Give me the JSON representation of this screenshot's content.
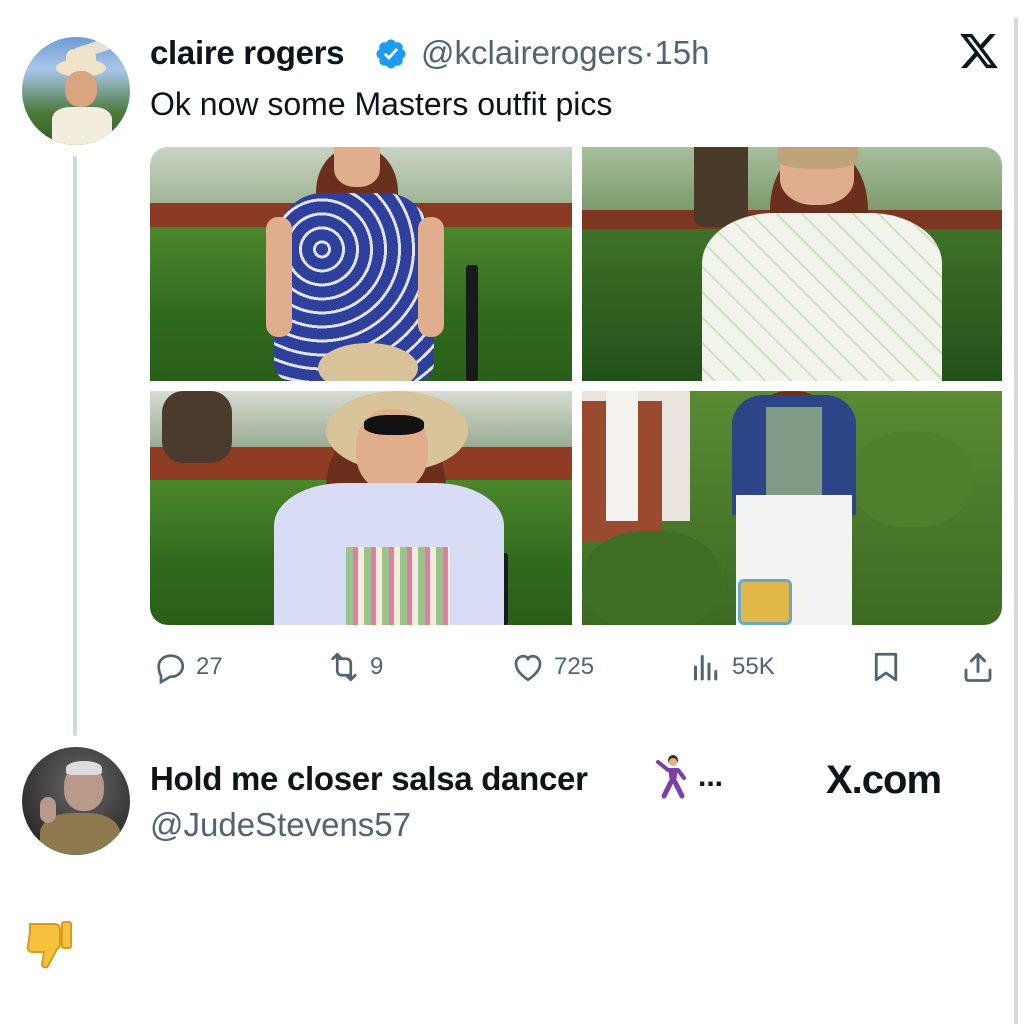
{
  "tweet": {
    "author_name": "claire rogers",
    "handle": "@kclairerogers",
    "separator": "·",
    "time": "15h",
    "text": "Ok now some Masters outfit pics",
    "verified_icon": "verified-badge-icon",
    "platform_icon": "x-logo-icon",
    "photos": [
      {
        "label": "photo-1"
      },
      {
        "label": "photo-2"
      },
      {
        "label": "photo-3"
      },
      {
        "label": "photo-4"
      }
    ],
    "actions": {
      "replies": "27",
      "retweets": "9",
      "likes": "725",
      "views": "55K"
    }
  },
  "reply": {
    "author_name": "Hold me closer salsa dancer",
    "emoji": "dancer-emoji",
    "ellipsis": "...",
    "handle": "@JudeStevens57",
    "watermark": "X.com",
    "reaction_emoji": "thumbs-down-emoji"
  },
  "colors": {
    "text": "#0f1419",
    "secondary": "#536471",
    "verified": "#1d9bf0",
    "thread_line": "#cfd9de"
  }
}
